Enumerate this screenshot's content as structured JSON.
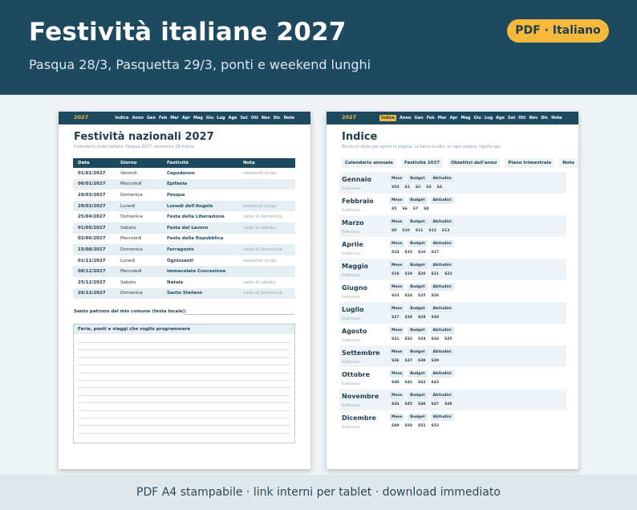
{
  "header": {
    "title": "Festività italiane 2027",
    "subtitle": "Pasqua 28/3, Pasquetta 29/3, ponti e weekend lunghi",
    "badge": "PDF · Italiano"
  },
  "footer": "PDF A4 stampabile · link interni per tablet · download immediato",
  "nav": {
    "year": "2027",
    "items": [
      "Indice",
      "Anno",
      "Gen",
      "Feb",
      "Mar",
      "Apr",
      "Mag",
      "Giu",
      "Lug",
      "Age",
      "Set",
      "Ott",
      "Nov",
      "Dic",
      "Note"
    ]
  },
  "page1": {
    "title": "Festività nazionali 2027",
    "subtitle": "Calendario civile italiano. Pasqua 2027: domenica 28 marzo.",
    "columns": [
      "Data",
      "Giorno",
      "Festività",
      "Nota"
    ],
    "rows": [
      [
        "01/01/2027",
        "Venerdì",
        "Capodanno",
        "weekend lungo"
      ],
      [
        "06/01/2027",
        "Mercoledì",
        "Epifania",
        ""
      ],
      [
        "28/03/2027",
        "Domenica",
        "Pasqua",
        ""
      ],
      [
        "29/03/2027",
        "Lunedì",
        "Lunedì dell'Angelo",
        "weekend lungo"
      ],
      [
        "25/04/2027",
        "Domenica",
        "Festa della Liberazione",
        "cade di domenica"
      ],
      [
        "01/05/2027",
        "Sabato",
        "Festa del Lavoro",
        "cade di sabato"
      ],
      [
        "02/06/2027",
        "Mercoledì",
        "Festa della Repubblica",
        ""
      ],
      [
        "15/08/2027",
        "Domenica",
        "Ferragosto",
        "cade di domenica"
      ],
      [
        "01/11/2027",
        "Lunedì",
        "Ognissanti",
        "weekend lungo"
      ],
      [
        "08/12/2027",
        "Mercoledì",
        "Immacolata Concezione",
        ""
      ],
      [
        "25/12/2027",
        "Sabato",
        "Natale",
        "cade di sabato"
      ],
      [
        "26/12/2027",
        "Domenica",
        "Santo Stefano",
        "cade di domenica"
      ]
    ],
    "patrono_label": "Santo patrono del mio comune (festa locale):",
    "notes_title": "Ferie, ponti e viaggi che voglio programmare"
  },
  "page2": {
    "title": "Indice",
    "subtitle": "Tocca un titolo per aprire la pagina. La barra in alto, su ogni pagina, riporta qui.",
    "buttons": [
      "Calendario annuale",
      "Festività 2027",
      "Obiettivi dell'anno",
      "Piano trimestrale",
      "Note"
    ],
    "month_buttons": [
      "Mese",
      "Budget",
      "Abitudini"
    ],
    "week_label": "Settimane",
    "months": [
      {
        "name": "Gennaio",
        "weeks": [
          "S53",
          "S1",
          "S2",
          "S3",
          "S4"
        ]
      },
      {
        "name": "Febbraio",
        "weeks": [
          "S5",
          "S6",
          "S7",
          "S8"
        ]
      },
      {
        "name": "Marzo",
        "weeks": [
          "S9",
          "S10",
          "S11",
          "S12",
          "S13"
        ]
      },
      {
        "name": "Aprile",
        "weeks": [
          "S14",
          "S15",
          "S16",
          "S17"
        ]
      },
      {
        "name": "Maggio",
        "weeks": [
          "S18",
          "S19",
          "S20",
          "S21",
          "S22"
        ]
      },
      {
        "name": "Giugno",
        "weeks": [
          "S23",
          "S24",
          "S25",
          "S26"
        ]
      },
      {
        "name": "Luglio",
        "weeks": [
          "S27",
          "S28",
          "S29",
          "S30"
        ]
      },
      {
        "name": "Agosto",
        "weeks": [
          "S31",
          "S32",
          "S33",
          "S34",
          "S35"
        ]
      },
      {
        "name": "Settembre",
        "weeks": [
          "S36",
          "S37",
          "S38",
          "S39"
        ]
      },
      {
        "name": "Ottobre",
        "weeks": [
          "S40",
          "S41",
          "S42",
          "S43"
        ]
      },
      {
        "name": "Novembre",
        "weeks": [
          "S44",
          "S45",
          "S46",
          "S47",
          "S48"
        ]
      },
      {
        "name": "Dicembre",
        "weeks": [
          "S49",
          "S50",
          "S51",
          "S52"
        ]
      }
    ]
  },
  "colors": {
    "primary": "#1e4a5f",
    "accent": "#f6b93b",
    "row_alt": "#e4eef3"
  }
}
